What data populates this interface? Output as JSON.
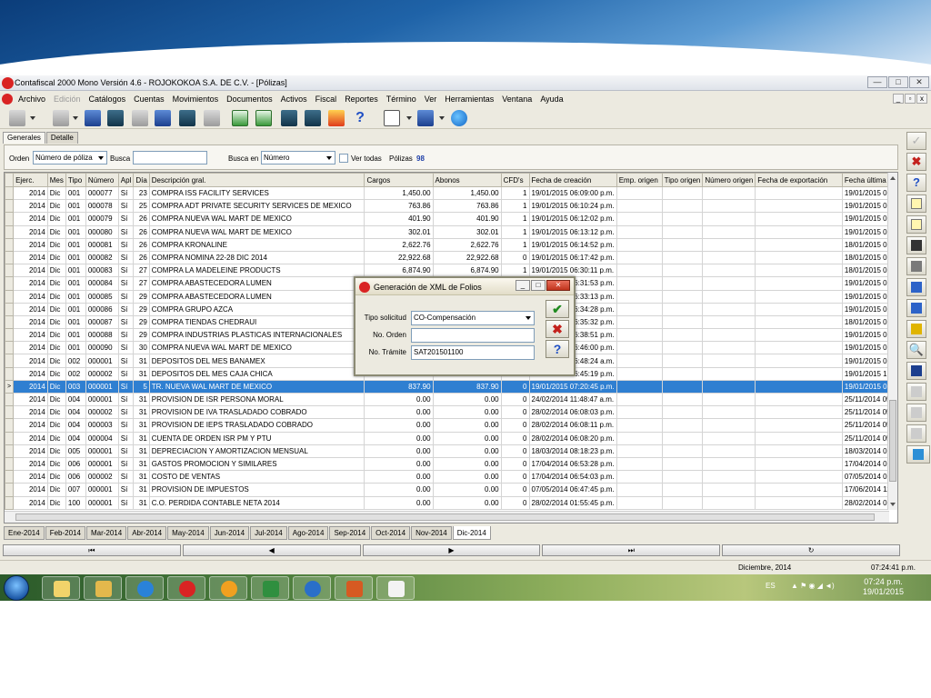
{
  "window": {
    "title": "Contafiscal 2000 Mono Versión 4.6 - ROJOKOKOA S.A. DE C.V. - [Pólizas]",
    "buttons": [
      "—",
      "□",
      "✕"
    ]
  },
  "menu": {
    "items": [
      "Archivo",
      "Edición",
      "Catálogos",
      "Cuentas",
      "Movimientos",
      "Documentos",
      "Activos",
      "Fiscal",
      "Reportes",
      "Término",
      "Ver",
      "Herramientas",
      "Ventana",
      "Ayuda"
    ],
    "disabled_index": 1,
    "mdi_buttons": [
      "_",
      "▫",
      "x"
    ]
  },
  "tabs": {
    "generales": "Generales",
    "detalle": "Detalle"
  },
  "filter": {
    "orden_label": "Orden",
    "orden_value": "Número de póliza",
    "busca_label": "Busca",
    "busca_value": "",
    "busca_en_label": "Busca en",
    "busca_en_value": "Número",
    "ver_todas_label": "Ver todas",
    "polizas_label": "Pólizas",
    "polizas_count": "98"
  },
  "grid": {
    "headers": [
      "Ejerc.",
      "Mes",
      "Tipo",
      "Número",
      "Apl",
      "Día",
      "Descripción gral.",
      "Cargos",
      "Abonos",
      "CFD's",
      "Fecha de creación",
      "Emp. origen",
      "Tipo origen",
      "Número origen",
      "Fecha de exportación",
      "Fecha última m"
    ],
    "rows": [
      [
        "2014",
        "Dic",
        "001",
        "000077",
        "Sí",
        "23",
        "COMPRA ISS FACILITY SERVICES",
        "1,450.00",
        "1,450.00",
        "1",
        "19/01/2015 06:09:00 p.m.",
        "",
        "",
        "",
        "",
        "19/01/2015 06"
      ],
      [
        "2014",
        "Dic",
        "001",
        "000078",
        "Sí",
        "25",
        "COMPRA ADT PRIVATE SECURITY SERVICES DE MEXICO",
        "763.86",
        "763.86",
        "1",
        "19/01/2015 06:10:24 p.m.",
        "",
        "",
        "",
        "",
        "19/01/2015 06"
      ],
      [
        "2014",
        "Dic",
        "001",
        "000079",
        "Sí",
        "26",
        "COMPRA NUEVA WAL MART DE MEXICO",
        "401.90",
        "401.90",
        "1",
        "19/01/2015 06:12:02 p.m.",
        "",
        "",
        "",
        "",
        "19/01/2015 06"
      ],
      [
        "2014",
        "Dic",
        "001",
        "000080",
        "Sí",
        "26",
        "COMPRA NUEVA WAL MART DE MEXICO",
        "302.01",
        "302.01",
        "1",
        "19/01/2015 06:13:12 p.m.",
        "",
        "",
        "",
        "",
        "19/01/2015 06"
      ],
      [
        "2014",
        "Dic",
        "001",
        "000081",
        "Sí",
        "26",
        "COMPRA KRONALINE",
        "2,622.76",
        "2,622.76",
        "1",
        "19/01/2015 06:14:52 p.m.",
        "",
        "",
        "",
        "",
        "18/01/2015 06"
      ],
      [
        "2014",
        "Dic",
        "001",
        "000082",
        "Sí",
        "26",
        "COMPRA NOMINA 22-28 DIC 2014",
        "22,922.68",
        "22,922.68",
        "0",
        "19/01/2015 06:17:42 p.m.",
        "",
        "",
        "",
        "",
        "18/01/2015 06"
      ],
      [
        "2014",
        "Dic",
        "001",
        "000083",
        "Sí",
        "27",
        "COMPRA LA MADELEINE PRODUCTS",
        "6,874.90",
        "6,874.90",
        "1",
        "19/01/2015 06:30:11 p.m.",
        "",
        "",
        "",
        "",
        "18/01/2015 06"
      ],
      [
        "2014",
        "Dic",
        "001",
        "000084",
        "Sí",
        "27",
        "COMPRA ABASTECEDORA LUMEN",
        "",
        "",
        "",
        "19/01/2015 06:31:53 p.m.",
        "",
        "",
        "",
        "",
        "19/01/2015 06"
      ],
      [
        "2014",
        "Dic",
        "001",
        "000085",
        "Sí",
        "29",
        "COMPRA ABASTECEDORA LUMEN",
        "",
        "",
        "",
        "19/01/2015 06:33:13 p.m.",
        "",
        "",
        "",
        "",
        "19/01/2015 06"
      ],
      [
        "2014",
        "Dic",
        "001",
        "000086",
        "Sí",
        "29",
        "COMPRA GRUPO AZCA",
        "",
        "",
        "",
        "19/01/2015 06:34:28 p.m.",
        "",
        "",
        "",
        "",
        "19/01/2015 06"
      ],
      [
        "2014",
        "Dic",
        "001",
        "000087",
        "Sí",
        "29",
        "COMPRA TIENDAS CHEDRAUI",
        "",
        "",
        "",
        "19/01/2015 06:35:32 p.m.",
        "",
        "",
        "",
        "",
        "18/01/2015 06"
      ],
      [
        "2014",
        "Dic",
        "001",
        "000088",
        "Sí",
        "29",
        "COMPRA INDUSTRIAS PLASTICAS INTERNACIONALES",
        "",
        "",
        "",
        "19/01/2015 06:38:51 p.m.",
        "",
        "",
        "",
        "",
        "19/01/2015 06"
      ],
      [
        "2014",
        "Dic",
        "001",
        "000090",
        "Sí",
        "30",
        "COMPRA NUEVA WAL MART DE MEXICO",
        "",
        "",
        "",
        "19/01/2015 06:46:00 p.m.",
        "",
        "",
        "",
        "",
        "19/01/2015 07"
      ],
      [
        "2014",
        "Dic",
        "002",
        "000001",
        "Sí",
        "31",
        "DEPOSITOS DEL MES BANAMEX",
        "",
        "",
        "",
        "19/01/2015 06:48:24 a.m.",
        "",
        "",
        "",
        "",
        "19/01/2015 01"
      ],
      [
        "2014",
        "Dic",
        "002",
        "000002",
        "Sí",
        "31",
        "DEPOSITOS DEL MES CAJA CHICA",
        "",
        "",
        "",
        "19/01/2015 06:45:19 p.m.",
        "",
        "",
        "",
        "",
        "19/01/2015 12"
      ],
      [
        "2014",
        "Dic",
        "003",
        "000001",
        "Sí",
        "5",
        "TR. NUEVA WAL MART DE MEXICO",
        "837.90",
        "837.90",
        "0",
        "19/01/2015 07:20:45 p.m.",
        "",
        "",
        "",
        "",
        "19/01/2015 07"
      ],
      [
        "2014",
        "Dic",
        "004",
        "000001",
        "Sí",
        "31",
        "PROVISION DE ISR PERSONA MORAL",
        "0.00",
        "0.00",
        "0",
        "24/02/2014 11:48:47 a.m.",
        "",
        "",
        "",
        "",
        "25/11/2014 05"
      ],
      [
        "2014",
        "Dic",
        "004",
        "000002",
        "Sí",
        "31",
        "PROVISION DE IVA TRASLADADO COBRADO",
        "0.00",
        "0.00",
        "0",
        "28/02/2014 06:08:03 p.m.",
        "",
        "",
        "",
        "",
        "25/11/2014 05"
      ],
      [
        "2014",
        "Dic",
        "004",
        "000003",
        "Sí",
        "31",
        "PROVISION DE IEPS TRASLADADO COBRADO",
        "0.00",
        "0.00",
        "0",
        "28/02/2014 06:08:11 p.m.",
        "",
        "",
        "",
        "",
        "25/11/2014 05"
      ],
      [
        "2014",
        "Dic",
        "004",
        "000004",
        "Sí",
        "31",
        "CUENTA DE ORDEN ISR PM Y PTU",
        "0.00",
        "0.00",
        "0",
        "28/02/2014 06:08:20 p.m.",
        "",
        "",
        "",
        "",
        "25/11/2014 05"
      ],
      [
        "2014",
        "Dic",
        "005",
        "000001",
        "Sí",
        "31",
        "DEPRECIACION Y AMORTIZACION MENSUAL",
        "0.00",
        "0.00",
        "0",
        "18/03/2014 08:18:23 p.m.",
        "",
        "",
        "",
        "",
        "18/03/2014 08"
      ],
      [
        "2014",
        "Dic",
        "006",
        "000001",
        "Sí",
        "31",
        "GASTOS PROMOCION Y SIMILARES",
        "0.00",
        "0.00",
        "0",
        "17/04/2014 06:53:28 p.m.",
        "",
        "",
        "",
        "",
        "17/04/2014 06"
      ],
      [
        "2014",
        "Dic",
        "006",
        "000002",
        "Sí",
        "31",
        "COSTO DE VENTAS",
        "0.00",
        "0.00",
        "0",
        "17/04/2014 06:54:03 p.m.",
        "",
        "",
        "",
        "",
        "07/05/2014 06"
      ],
      [
        "2014",
        "Dic",
        "007",
        "000001",
        "Sí",
        "31",
        "PROVISION DE IMPUESTOS",
        "0.00",
        "0.00",
        "0",
        "07/05/2014 06:47:45 p.m.",
        "",
        "",
        "",
        "",
        "17/06/2014 11"
      ],
      [
        "2014",
        "Dic",
        "100",
        "000001",
        "Sí",
        "31",
        "C.O. PERDIDA CONTABLE NETA 2014",
        "0.00",
        "0.00",
        "0",
        "28/02/2014 01:55:45 p.m.",
        "",
        "",
        "",
        "",
        "28/02/2014 01"
      ]
    ],
    "selected_row": 15,
    "selected_marker": ">"
  },
  "months": [
    "Ene-2014",
    "Feb-2014",
    "Mar-2014",
    "Abr-2014",
    "May-2014",
    "Jun-2014",
    "Jul-2014",
    "Ago-2014",
    "Sep-2014",
    "Oct-2014",
    "Nov-2014",
    "Dic-2014"
  ],
  "active_month": 11,
  "nav": {
    "first": "⏮",
    "prev": "◀",
    "next": "▶",
    "last": "⏭",
    "refresh": "↻"
  },
  "status": {
    "period": "Diciembre, 2014",
    "time": "07:24:41 p.m."
  },
  "dialog": {
    "title": "Generación de XML de Folios",
    "tipo_label": "Tipo solicitud",
    "tipo_value": "CO-Compensación",
    "orden_label": "No. Orden",
    "orden_value": "",
    "tramite_label": "No. Trámite",
    "tramite_value": "SAT201501100",
    "ok_glyph": "✔",
    "cancel_glyph": "✖",
    "help_glyph": "?"
  },
  "taskbar": {
    "lang": "ES",
    "time": "07:24 p.m.",
    "date": "19/01/2015"
  },
  "icons": [
    "start-icon",
    "windows-explorer-icon",
    "folder-icon",
    "internet-explorer-icon",
    "contafiscal-icon",
    "aspel-icon",
    "excel-icon",
    "nomina-icon",
    "powerpoint-icon",
    "notepad-icon"
  ]
}
